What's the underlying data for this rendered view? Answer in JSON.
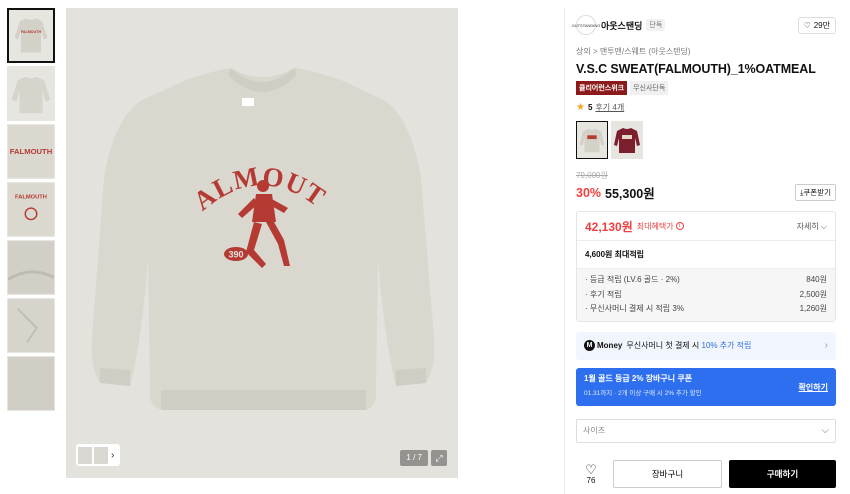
{
  "gallery": {
    "thumbnails": [
      "thumb-1",
      "thumb-2",
      "thumb-3",
      "thumb-4",
      "thumb-5",
      "thumb-6",
      "thumb-7"
    ],
    "graphic_text": "FALMOUTH",
    "graphic_number": "390",
    "counter": "1 / 7",
    "expand_icon": "expand-icon",
    "mini_arrow": "›"
  },
  "brand": {
    "logo_text": "OUTSTANDING",
    "name": "아웃스탠딩",
    "tag": "단독",
    "like_icon": "♡",
    "like_count": "29만"
  },
  "breadcrumb": "상의 > 맨투맨/스웨트 (아웃스탠딩)",
  "product": {
    "title": "V.S.C SWEAT(FALMOUTH)_1%OATMEAL",
    "badge_red": "클리어런스위크",
    "badge_gray": "무신사단독",
    "rating": "5",
    "review_link": "후기 4개",
    "original_price": "79,000원",
    "discount": "30%",
    "price": "55,300원",
    "coupon_btn": "⤓쿠폰받기"
  },
  "benefits": {
    "best_price": "42,130원",
    "best_label": "최대혜택가",
    "info_icon": "i",
    "detail_toggle": "자세히 ⌵",
    "points_total": "4,600원 최대적립",
    "points": [
      {
        "label": "· 등급 적립 (LV.6 골드 · 2%)",
        "value": "840원"
      },
      {
        "label": "· 후기 적립",
        "value": "2,500원"
      },
      {
        "label": "· 무신사머니 결제 시 적립 3%",
        "value": "1,260원"
      }
    ]
  },
  "money_banner": {
    "logo": "M",
    "brand": "Money",
    "text": "무신사머니 첫 결제 시",
    "accent": "10% 추가 적립",
    "chevron": "›"
  },
  "coupon_banner": {
    "title": "1월 골드 등급 2% 장바구니 쿠폰",
    "subtitle": "01.31까지 · 2개 이상 구매 시 2% 추가 할인",
    "confirm": "확인하기"
  },
  "size_select": {
    "placeholder": "사이즈",
    "chevron": "⌵"
  },
  "actions": {
    "heart": "♡",
    "like_count": "76",
    "cart": "장바구니",
    "buy": "구매하기"
  },
  "colors": {
    "discount_red": "#ef3f3f",
    "coupon_blue": "#2e6ff0",
    "badge_red": "#8c1a1a",
    "print_red": "#b53a33",
    "sweat_oatmeal": "#d9d7ce"
  }
}
